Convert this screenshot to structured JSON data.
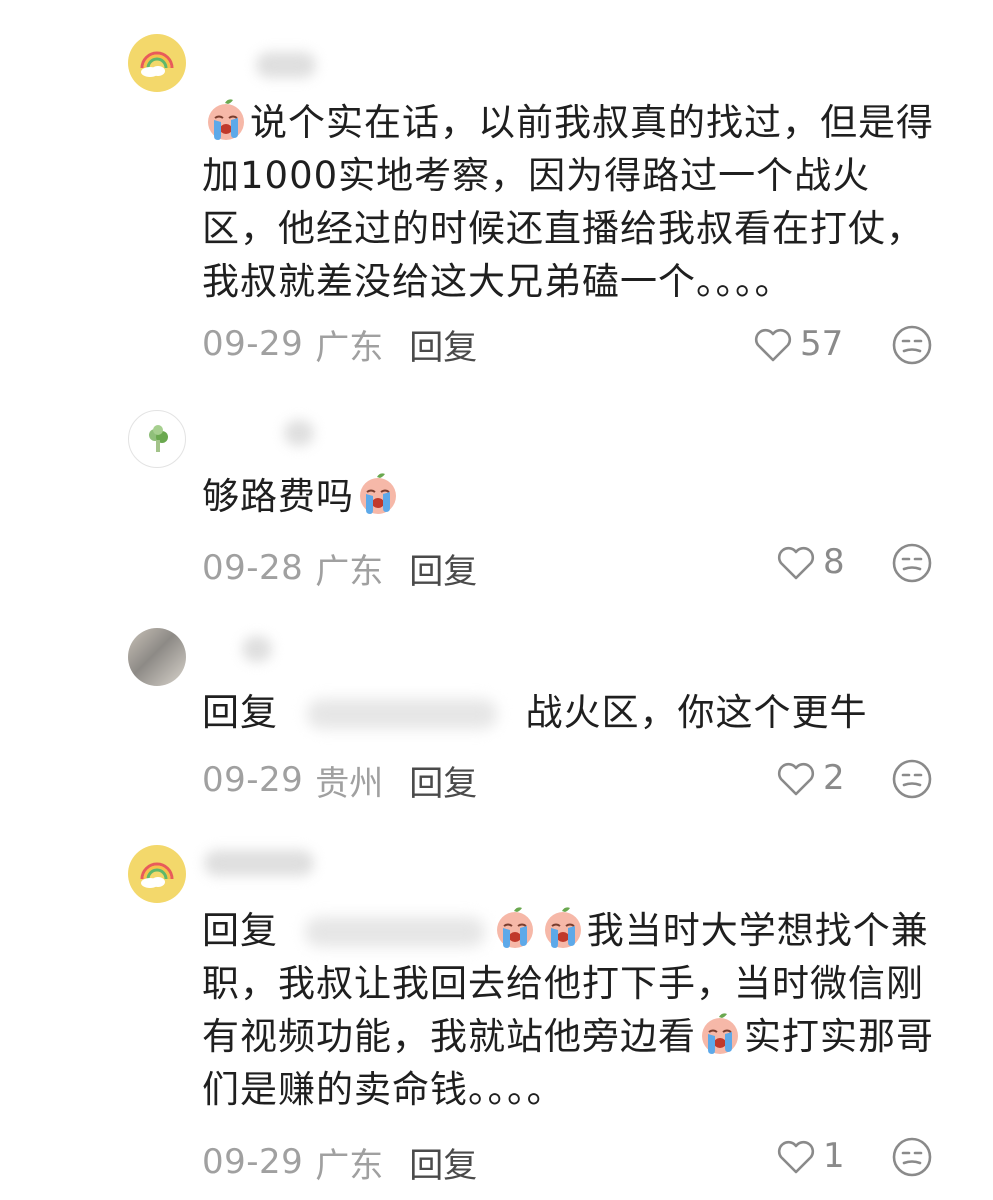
{
  "comments": [
    {
      "text_parts": [
        "说个实在话，以前我叔真的找过，但是得加1000实地考察，因为得路过一个战火区，他经过的时候还直播给我叔看在打仗，我叔就差没给这大兄弟磕一个。。。。"
      ],
      "date": "09-29",
      "location": "广东",
      "reply_label": "回复",
      "likes": "57",
      "like_icon": "heart-icon",
      "dislike_icon": "meh-face-icon"
    },
    {
      "text_parts": [
        "够路费吗"
      ],
      "date": "09-28",
      "location": "广东",
      "reply_label": "回复",
      "likes": "8",
      "like_icon": "heart-icon",
      "dislike_icon": "meh-face-icon"
    },
    {
      "text_parts": [
        "回复",
        "战火区，你这个更牛"
      ],
      "date": "09-29",
      "location": "贵州",
      "reply_label": "回复",
      "likes": "2",
      "like_icon": "heart-icon",
      "dislike_icon": "meh-face-icon"
    },
    {
      "text_parts": [
        "回复",
        "我当时大学想找个兼职，我叔让我回去给他打下手，当时微信刚有视频功能，我就站他旁边看",
        "实打实那哥们是赚的卖命钱。。。。"
      ],
      "date": "09-29",
      "location": "广东",
      "reply_label": "回复",
      "likes": "1",
      "like_icon": "heart-icon",
      "dislike_icon": "meh-face-icon"
    }
  ],
  "colors": {
    "text": "#1f1f1f",
    "meta": "#a0a0a0",
    "reply": "#4a4a4a",
    "icon": "#8a8a8a",
    "avatar_yellow": "#f3d86b"
  }
}
